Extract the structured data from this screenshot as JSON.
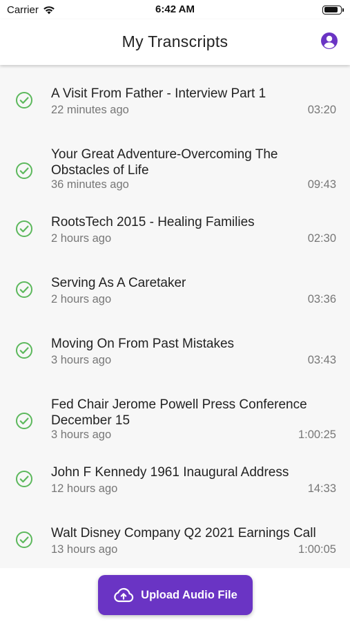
{
  "status_bar": {
    "carrier": "Carrier",
    "time": "6:42 AM",
    "battery_level": 0.9
  },
  "header": {
    "title": "My Transcripts",
    "profile_icon": "account-circle-icon"
  },
  "colors": {
    "accent": "#6a34c4",
    "check": "#5cb85c",
    "list_bg": "#f7f7f7"
  },
  "transcripts": [
    {
      "title": "A Visit From Father - Interview Part 1",
      "time_ago": "22 minutes ago",
      "duration": "03:20",
      "status": "completed"
    },
    {
      "title": "Your Great Adventure-Overcoming The Obstacles of Life",
      "time_ago": "36 minutes ago",
      "duration": "09:43",
      "status": "completed"
    },
    {
      "title": "RootsTech 2015 - Healing Families",
      "time_ago": "2 hours ago",
      "duration": "02:30",
      "status": "completed"
    },
    {
      "title": "Serving As A Caretaker",
      "time_ago": "2 hours ago",
      "duration": "03:36",
      "status": "completed"
    },
    {
      "title": "Moving On From Past Mistakes",
      "time_ago": "3 hours ago",
      "duration": "03:43",
      "status": "completed"
    },
    {
      "title": "Fed Chair Jerome Powell Press Conference December 15",
      "time_ago": "3 hours ago",
      "duration": "1:00:25",
      "status": "completed"
    },
    {
      "title": "John F Kennedy 1961 Inaugural Address",
      "time_ago": "12 hours ago",
      "duration": "14:33",
      "status": "completed"
    },
    {
      "title": "Walt Disney Company Q2 2021 Earnings Call",
      "time_ago": "13 hours ago",
      "duration": "1:00:05",
      "status": "completed"
    }
  ],
  "upload_button": {
    "label": "Upload Audio File",
    "icon": "cloud-upload-icon"
  }
}
